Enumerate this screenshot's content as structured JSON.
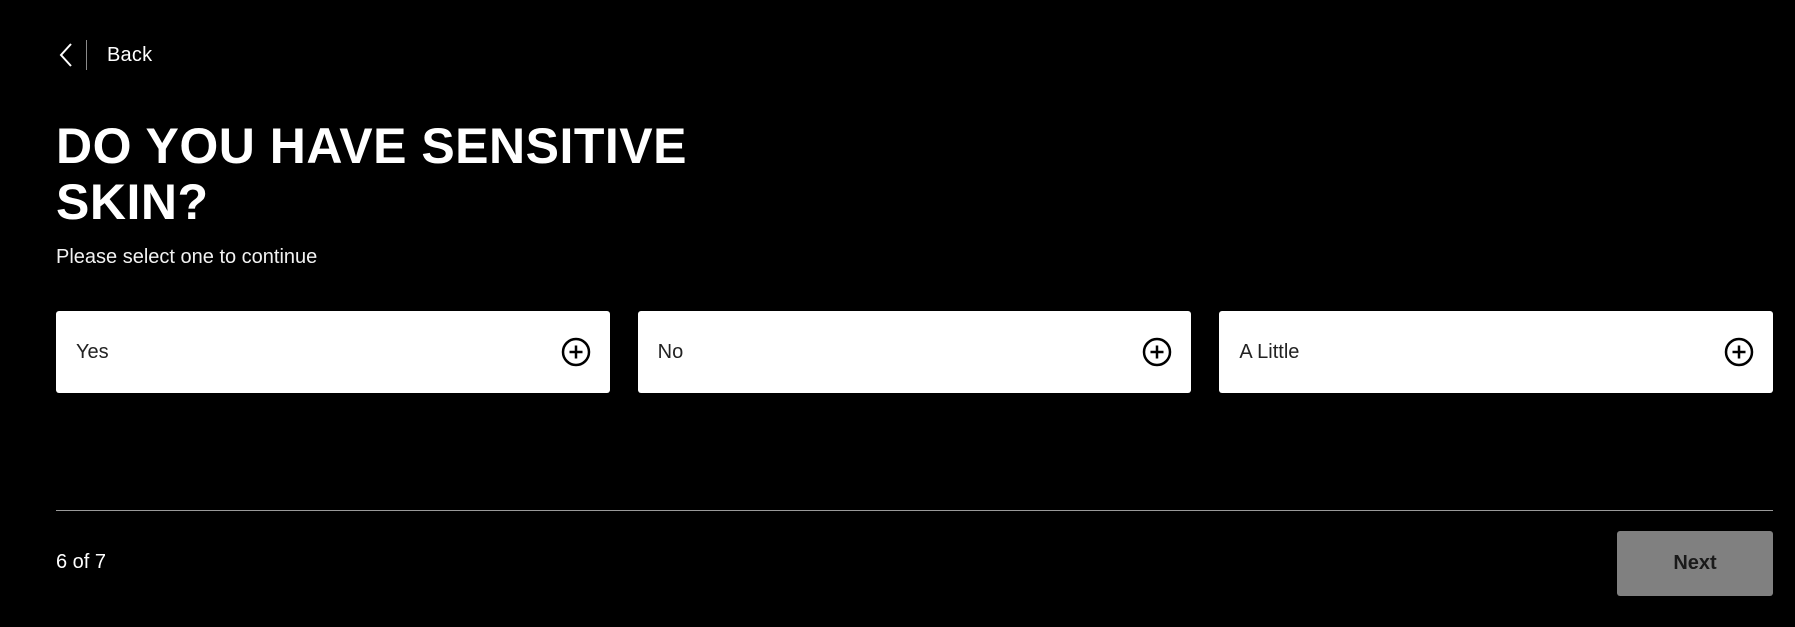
{
  "nav": {
    "back_label": "Back",
    "back_icon": "chevron-left-icon"
  },
  "question": {
    "title": "DO YOU HAVE SENSITIVE SKIN?",
    "subtitle": "Please select one to continue"
  },
  "options": [
    {
      "label": "Yes",
      "icon": "plus-circle-icon"
    },
    {
      "label": "No",
      "icon": "plus-circle-icon"
    },
    {
      "label": "A Little",
      "icon": "plus-circle-icon"
    }
  ],
  "footer": {
    "progress_text": "6 of 7",
    "next_label": "Next",
    "next_disabled": true
  },
  "colors": {
    "background": "#000000",
    "option_background": "#ffffff",
    "next_disabled_background": "#808080",
    "divider": "#9a9a9a"
  }
}
